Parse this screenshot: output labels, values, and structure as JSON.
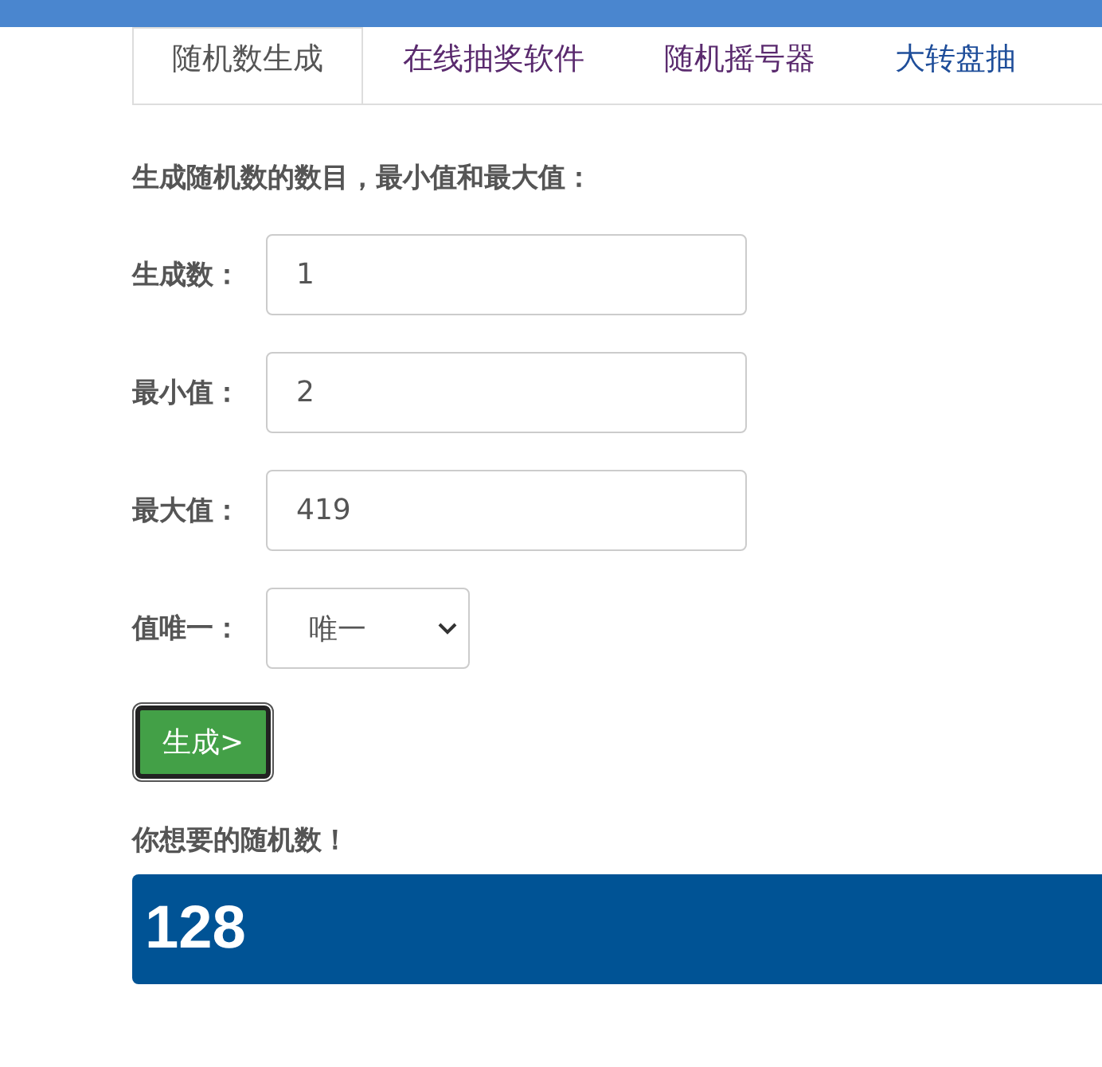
{
  "tabs": [
    {
      "label": "随机数生成",
      "selected": true,
      "visited": false
    },
    {
      "label": "在线抽奖软件",
      "selected": false,
      "visited": true
    },
    {
      "label": "随机摇号器",
      "selected": false,
      "visited": true
    },
    {
      "label": "大转盘抽",
      "selected": false,
      "visited": false
    }
  ],
  "heading": "生成随机数的数目，最小值和最大值：",
  "fields": [
    {
      "kind": "input",
      "label": "生成数：",
      "value": "1"
    },
    {
      "kind": "input",
      "label": "最小值：",
      "value": "2"
    },
    {
      "kind": "input",
      "label": "最大值：",
      "value": "419"
    },
    {
      "kind": "select",
      "label": "值唯一：",
      "value": "唯一"
    }
  ],
  "generate_button": "生成>",
  "result_label": "你想要的随机数！",
  "result": "128"
}
